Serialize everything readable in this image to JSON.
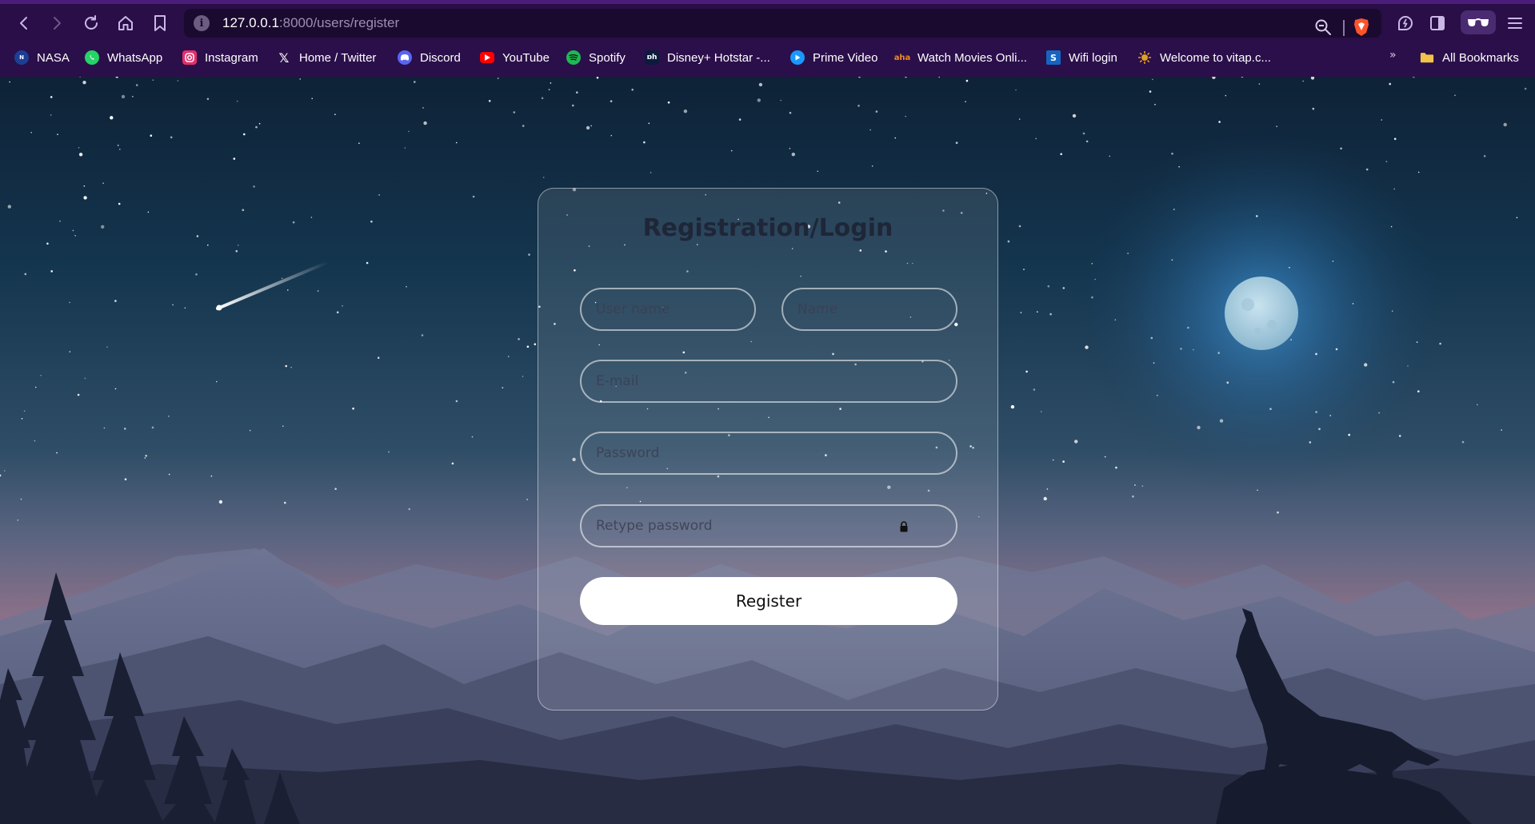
{
  "browser": {
    "url_host": "127.0.0.1",
    "url_rest": ":8000/users/register",
    "icons": [
      "back-icon",
      "forward-icon",
      "reload-icon",
      "home-icon",
      "bookmark-icon",
      "site-info-icon",
      "zoom-icon",
      "brave-shield-icon",
      "leo-ai-icon",
      "sidebar-icon",
      "reader-glasses-icon",
      "menu-icon"
    ]
  },
  "bookmarks": {
    "items": [
      {
        "label": "NASA",
        "color": "#1c3f95"
      },
      {
        "label": "WhatsApp",
        "color": "#25d366"
      },
      {
        "label": "Instagram",
        "color": "#e1306c"
      },
      {
        "label": "Home / Twitter",
        "color": "#000000"
      },
      {
        "label": "Discord",
        "color": "#5865f2"
      },
      {
        "label": "YouTube",
        "color": "#ff0000"
      },
      {
        "label": "Spotify",
        "color": "#1db954"
      },
      {
        "label": "Disney+ Hotstar -...",
        "color": "#0c1a3d"
      },
      {
        "label": "Prime Video",
        "color": "#1a98ff"
      },
      {
        "label": "Watch Movies Onli...",
        "color": "#f08a24"
      },
      {
        "label": "Wifi login",
        "color": "#1565c0"
      },
      {
        "label": "Welcome to vitap.c...",
        "color": "#e0a020"
      }
    ],
    "more": "»",
    "all_bookmarks": "All Bookmarks"
  },
  "form": {
    "title": "Registration/Login",
    "username_placeholder": "User name",
    "name_placeholder": "Name",
    "email_placeholder": "E-mail",
    "password_placeholder": "Password",
    "retype_placeholder": "Retype password",
    "register_label": "Register"
  },
  "colors": {
    "chrome": "#2b0f4a",
    "sky_top": "#0f2a44",
    "sky_bottom": "#6d6a86",
    "moon": "#a9cfe0"
  }
}
